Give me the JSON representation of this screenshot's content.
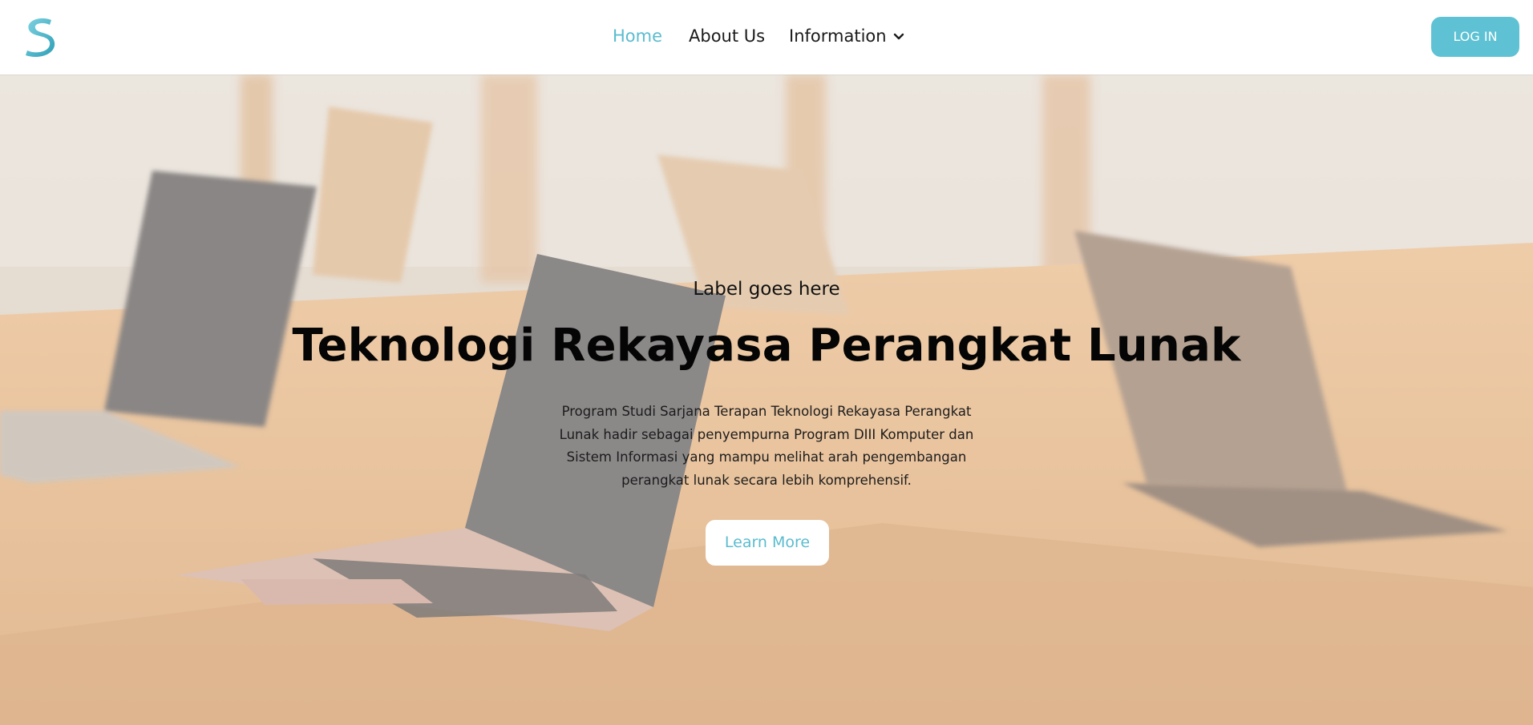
{
  "brand": {
    "accent_color": "#5ec2d4",
    "logo_icon": "s-logo-icon"
  },
  "nav": {
    "items": [
      {
        "label": "Home",
        "active": true
      },
      {
        "label": "About Us",
        "active": false
      },
      {
        "label": "Information",
        "active": false,
        "has_dropdown": true
      }
    ],
    "dropdown_icon": "chevron-down-icon",
    "login_label": "LOG IN"
  },
  "hero": {
    "label": "Label goes here",
    "title": "Teknologi Rekayasa Perangkat Lunak",
    "description": "Program Studi Sarjana Terapan Teknologi Rekayasa Perangkat Lunak hadir sebagai penyempurna Program DIII Komputer dan Sistem Informasi yang mampu melihat arah pengembangan perangkat lunak secara lebih komprehensif.",
    "cta_label": "Learn More",
    "background_image": "laptops-on-wooden-table"
  }
}
